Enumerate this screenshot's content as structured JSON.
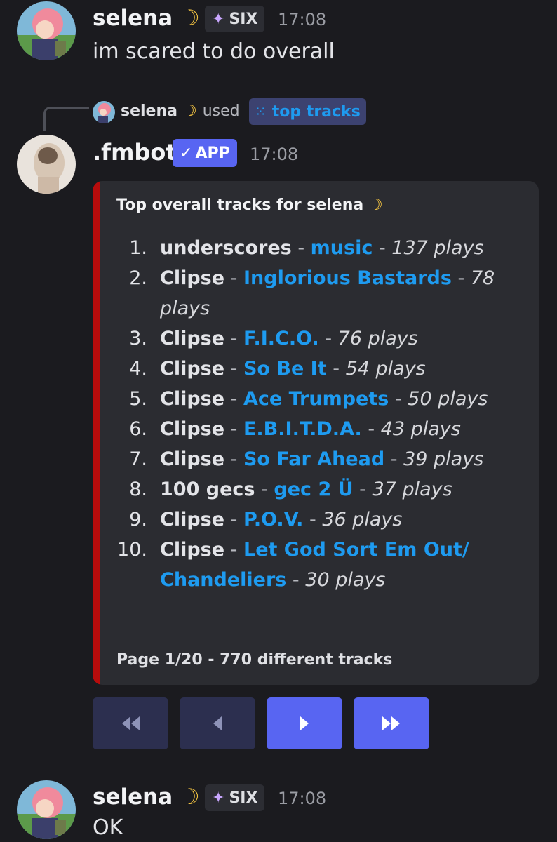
{
  "messages": {
    "first": {
      "author": "selena",
      "tag": "SIX",
      "time": "17:08",
      "text": "im scared to do overall"
    },
    "reply_ref": {
      "author": "selena",
      "verb": "used",
      "command": "top tracks"
    },
    "bot": {
      "author": ".fmbot",
      "badge": "APP",
      "time": "17:08"
    },
    "last": {
      "author": "selena",
      "tag": "SIX",
      "time": "17:08",
      "text": "OK"
    }
  },
  "embed": {
    "title": "Top overall tracks for selena",
    "accent_color": "#b70c0c",
    "footer": "Page 1/20 - 770 different tracks",
    "tracks": [
      {
        "num": "1.",
        "artist": "underscores",
        "title": "music",
        "plays": "137 plays"
      },
      {
        "num": "2.",
        "artist": "Clipse",
        "title": "Inglorious Bastards",
        "plays": "78 plays"
      },
      {
        "num": "3.",
        "artist": "Clipse",
        "title": "F.I.C.O.",
        "plays": "76 plays"
      },
      {
        "num": "4.",
        "artist": "Clipse",
        "title": "So Be It",
        "plays": "54 plays"
      },
      {
        "num": "5.",
        "artist": "Clipse",
        "title": "Ace Trumpets",
        "plays": "50 plays"
      },
      {
        "num": "6.",
        "artist": "Clipse",
        "title": "E.B.I.T.D.A.",
        "plays": "43 plays"
      },
      {
        "num": "7.",
        "artist": "Clipse",
        "title": "So Far Ahead",
        "plays": "39 plays"
      },
      {
        "num": "8.",
        "artist": "100 gecs",
        "title": "gec 2 Ü",
        "plays": "37 plays"
      },
      {
        "num": "9.",
        "artist": "Clipse",
        "title": "P.O.V.",
        "plays": "36 plays"
      },
      {
        "num": "10.",
        "artist": "Clipse",
        "title": "Let God Sort Em Out/ Chandeliers",
        "plays": "30 plays"
      }
    ]
  },
  "pagination": {
    "buttons": [
      {
        "icon": "rewind-first-icon",
        "enabled": false
      },
      {
        "icon": "previous-icon",
        "enabled": false
      },
      {
        "icon": "next-icon",
        "enabled": true
      },
      {
        "icon": "fast-forward-last-icon",
        "enabled": true
      }
    ]
  },
  "colors": {
    "background": "#1b1b1f",
    "embed_bg": "#2b2c31",
    "link": "#1e9bf0",
    "blurple": "#5865f2"
  }
}
